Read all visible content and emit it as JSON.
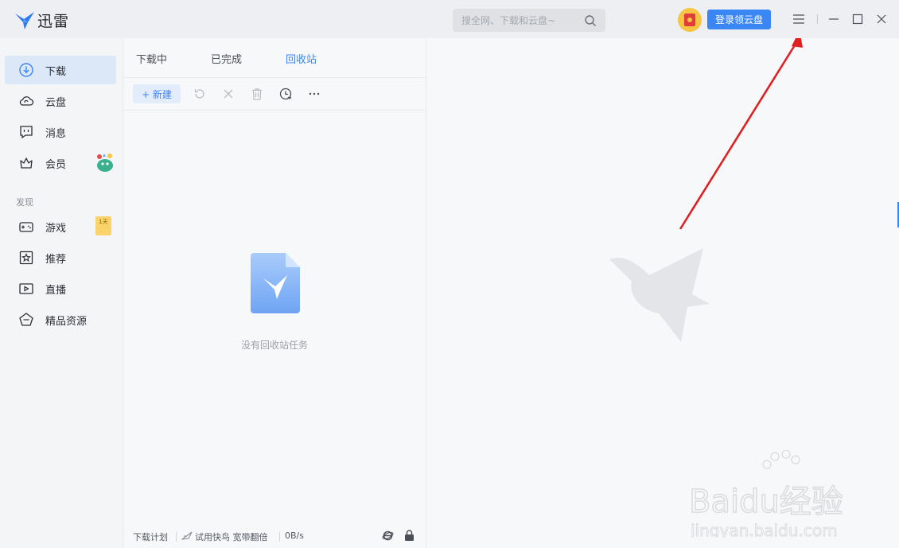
{
  "app": {
    "name": "迅雷",
    "search_placeholder": "搜全网、下载和云盘~",
    "login_button": "登录领云盘"
  },
  "sidebar": {
    "items": [
      {
        "label": "下载",
        "icon": "download-icon",
        "active": true
      },
      {
        "label": "云盘",
        "icon": "cloud-icon"
      },
      {
        "label": "消息",
        "icon": "message-icon"
      },
      {
        "label": "会员",
        "icon": "crown-icon"
      }
    ],
    "section_label": "发现",
    "discover_items": [
      {
        "label": "游戏",
        "icon": "gamepad-icon"
      },
      {
        "label": "推荐",
        "icon": "star-icon"
      },
      {
        "label": "直播",
        "icon": "live-icon"
      },
      {
        "label": "精品资源",
        "icon": "gem-icon"
      }
    ],
    "game_badge": "1天"
  },
  "download": {
    "tabs": [
      "下载中",
      "已完成",
      "回收站"
    ],
    "active_tab": 2,
    "new_button": "+ 新建",
    "empty_text": "没有回收站任务",
    "status": {
      "plan": "下载计划",
      "trial": "试用快鸟 宽带翻倍",
      "speed": "0B/s"
    }
  },
  "watermark": {
    "brand": "Baidu经验",
    "url": "jingyan.baidu.com"
  },
  "colors": {
    "accent": "#3b86f5",
    "annotation": "#e02020"
  }
}
